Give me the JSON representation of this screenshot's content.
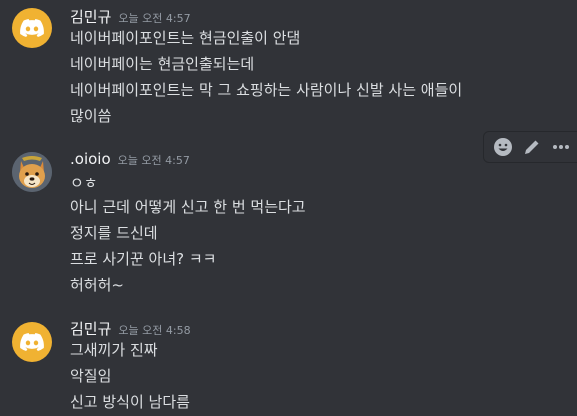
{
  "colors": {
    "background": "#313338",
    "text": "#dbdee1",
    "username": "#f2f3f5",
    "timestamp": "#949ba4",
    "avatar_discord": "#f0b232"
  },
  "messages": [
    {
      "avatar_icon": "discord-logo-icon",
      "username": "김민규",
      "timestamp": "오늘 오전 4:57",
      "lines": [
        "네이버페이포인트는 현금인출이 안댐",
        "네이버페이는 현금인출되는데",
        "네이버페이포인트는 막 그 쇼핑하는 사람이나 신발 사는 애들이",
        "많이씀"
      ]
    },
    {
      "avatar_icon": "shiba-dog-avatar",
      "username": ".oioio",
      "timestamp": "오늘 오전 4:57",
      "lines": [
        "ㅇㅎ",
        "아니 근데 어떻게 신고 한 번 먹는다고",
        "정지를 드신데",
        "프로 사기꾼 아녀? ㅋㅋ",
        "허허허~"
      ]
    },
    {
      "avatar_icon": "discord-logo-icon",
      "username": "김민규",
      "timestamp": "오늘 오전 4:58",
      "lines": [
        "그새끼가 진짜",
        "악질임",
        "신고 방식이 남다름"
      ]
    }
  ],
  "toolbar": {
    "icons": [
      "add-reaction-icon",
      "edit-icon",
      "more-options-icon"
    ]
  }
}
